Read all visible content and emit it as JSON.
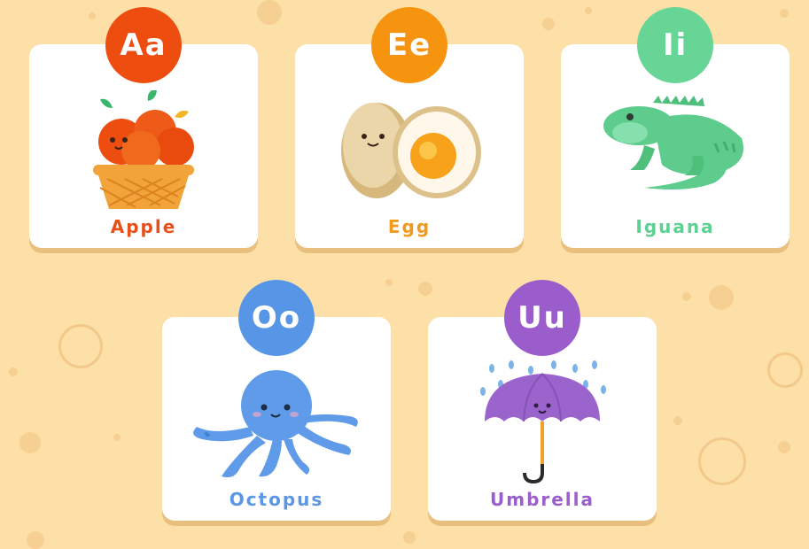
{
  "cards": [
    {
      "letter": "Aa",
      "word": "Apple",
      "color": "#ee4d10",
      "text_color": "#e8501a",
      "icon": "apple-basket-icon"
    },
    {
      "letter": "Ee",
      "word": "Egg",
      "color": "#f7940f",
      "text_color": "#f29a1b",
      "icon": "egg-icon"
    },
    {
      "letter": "Ii",
      "word": "Iguana",
      "color": "#67d596",
      "text_color": "#5ed093",
      "icon": "iguana-icon"
    },
    {
      "letter": "Oo",
      "word": "Octopus",
      "color": "#5796e6",
      "text_color": "#5a97e5",
      "icon": "octopus-icon"
    },
    {
      "letter": "Uu",
      "word": "Umbrella",
      "color": "#9b5ccc",
      "text_color": "#9a5fcc",
      "icon": "umbrella-icon"
    }
  ]
}
